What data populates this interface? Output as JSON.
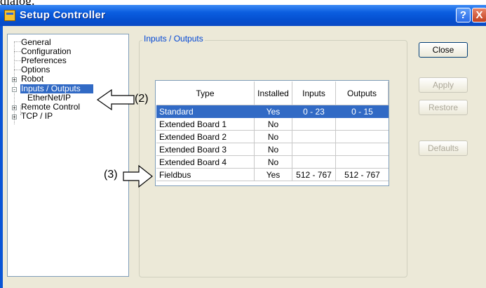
{
  "caption": "dialog.",
  "window": {
    "title": "Setup Controller",
    "help_glyph": "?",
    "close_glyph": "X"
  },
  "tree": {
    "items": [
      {
        "label": "General"
      },
      {
        "label": "Configuration"
      },
      {
        "label": "Preferences"
      },
      {
        "label": "Options"
      },
      {
        "label": "Robot",
        "expander": "+"
      },
      {
        "label": "Inputs / Outputs",
        "expander": "-",
        "selected": true
      },
      {
        "label": "EtherNet/IP"
      },
      {
        "label": "Remote Control",
        "expander": "+"
      },
      {
        "label": "TCP / IP",
        "expander": "+"
      }
    ]
  },
  "group": {
    "title": "Inputs / Outputs"
  },
  "table": {
    "columns": [
      "Type",
      "Installed",
      "Inputs",
      "Outputs"
    ],
    "rows": [
      {
        "type": "Standard",
        "installed": "Yes",
        "inputs": "0 - 23",
        "outputs": "0 - 15",
        "selected": true
      },
      {
        "type": "Extended Board 1",
        "installed": "No",
        "inputs": "",
        "outputs": ""
      },
      {
        "type": "Extended Board 2",
        "installed": "No",
        "inputs": "",
        "outputs": ""
      },
      {
        "type": "Extended Board 3",
        "installed": "No",
        "inputs": "",
        "outputs": ""
      },
      {
        "type": "Extended Board 4",
        "installed": "No",
        "inputs": "",
        "outputs": ""
      },
      {
        "type": "Fieldbus",
        "installed": "Yes",
        "inputs": "512 - 767",
        "outputs": "512 - 767"
      }
    ]
  },
  "buttons": {
    "close": "Close",
    "apply": "Apply",
    "restore": "Restore",
    "defaults": "Defaults"
  },
  "annotations": {
    "callout_2": "(2)",
    "callout_3": "(3)"
  },
  "colors": {
    "titlebar": "#0a55d6",
    "selection": "#316ac5",
    "dialog_bg": "#ece9d8",
    "group_title": "#0046d5"
  }
}
